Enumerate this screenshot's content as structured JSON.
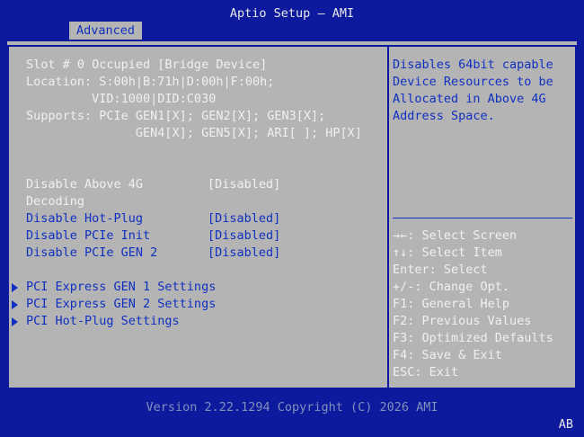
{
  "title": "Aptio Setup – AMI",
  "tabs": [
    {
      "label": "Advanced"
    }
  ],
  "info_lines": [
    "Slot # 0 Occupied [Bridge Device]",
    "Location: S:00h|B:71h|D:00h|F:00h;",
    "         VID:1000|DID:C030",
    "Supports: PCIe GEN1[X]; GEN2[X]; GEN3[X];",
    "               GEN4[X]; GEN5[X]; ARI[ ]; HP[X]"
  ],
  "options": [
    {
      "label": "Disable Above 4G",
      "label2": "Decoding",
      "value": "[Disabled]"
    },
    {
      "label": "Disable Hot-Plug",
      "value": "[Disabled]"
    },
    {
      "label": "Disable PCIe Init",
      "value": "[Disabled]"
    },
    {
      "label": "Disable PCIe GEN 2",
      "value": "[Disabled]"
    }
  ],
  "submenus": [
    {
      "label": "PCI Express GEN 1 Settings"
    },
    {
      "label": "PCI Express GEN 2 Settings"
    },
    {
      "label": "PCI Hot-Plug Settings"
    }
  ],
  "help_lines": [
    "Disables 64bit capable",
    "Device Resources to be",
    "Allocated in Above 4G",
    "Address Space."
  ],
  "keys": [
    "→←: Select Screen",
    "↑↓: Select Item",
    "Enter: Select",
    "+/-: Change Opt.",
    "F1: General Help",
    "F2: Previous Values",
    "F3: Optimized Defaults",
    "F4: Save & Exit",
    "ESC: Exit"
  ],
  "footer": {
    "version": "Version 2.22.1294 Copyright (C) 2026 AMI",
    "corner": "AB"
  },
  "colors": {
    "background": "#0d1a9e",
    "panel": "#b4b4b4",
    "highlight": "#f0f0f0",
    "option_text": "#1030c0"
  }
}
